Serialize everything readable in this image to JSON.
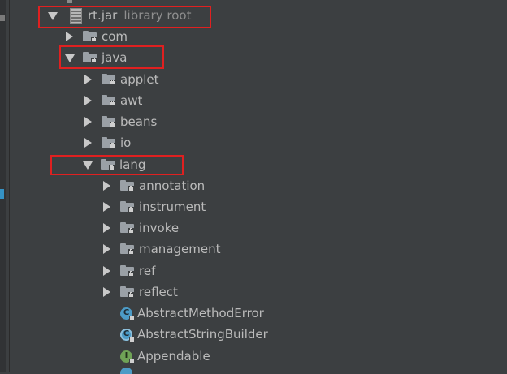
{
  "tree": {
    "root": {
      "label": "rt.jar",
      "sublabel": "library root"
    },
    "com": {
      "label": "com"
    },
    "java": {
      "label": "java"
    },
    "java_children": [
      {
        "label": "applet"
      },
      {
        "label": "awt"
      },
      {
        "label": "beans"
      },
      {
        "label": "io"
      }
    ],
    "lang": {
      "label": "lang"
    },
    "lang_packages": [
      {
        "label": "annotation"
      },
      {
        "label": "instrument"
      },
      {
        "label": "invoke"
      },
      {
        "label": "management"
      },
      {
        "label": "ref"
      },
      {
        "label": "reflect"
      }
    ],
    "lang_classes": [
      {
        "label": "AbstractMethodError",
        "kind": "class",
        "icon_letter": "C"
      },
      {
        "label": "AbstractStringBuilder",
        "kind": "abstract-class",
        "icon_letter": "C"
      },
      {
        "label": "Appendable",
        "kind": "interface",
        "icon_letter": "I"
      }
    ]
  },
  "colors": {
    "background": "#3c3f41",
    "text": "#bbbbbb",
    "highlight": "#e02020",
    "class_icon": "#4c9bc6",
    "interface_icon": "#6fa356"
  }
}
